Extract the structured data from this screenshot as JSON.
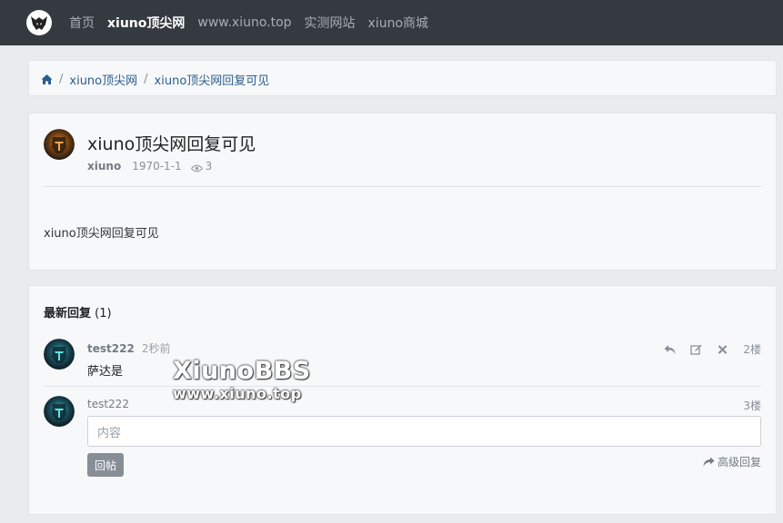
{
  "nav": {
    "links": [
      "首页",
      "xiuno顶尖网",
      "www.xiuno.top",
      "实测网站",
      "xiuno商城"
    ]
  },
  "breadcrumb": {
    "items": [
      "xiuno顶尖网",
      "xiuno顶尖网回复可见"
    ]
  },
  "thread": {
    "title": "xiuno顶尖网回复可见",
    "author": "xiuno",
    "date": "1970-1-1",
    "views": "3",
    "body": "xiuno顶尖网回复可见"
  },
  "replies": {
    "heading": "最新回复",
    "count": "(1)",
    "post": {
      "user": "test222",
      "time": "2秒前",
      "content": "萨达是",
      "floor": "2楼"
    },
    "form": {
      "user": "test222",
      "floor": "3楼",
      "placeholder": "内容",
      "submit_label": "回帖",
      "advanced_label": "高级回复"
    }
  },
  "watermark": {
    "line1": "XiunoBBS",
    "line2": "www.xiuno.top"
  },
  "colors": {
    "navbar": "#343a40",
    "link": "#2a5d8f",
    "button": "#868e96"
  }
}
